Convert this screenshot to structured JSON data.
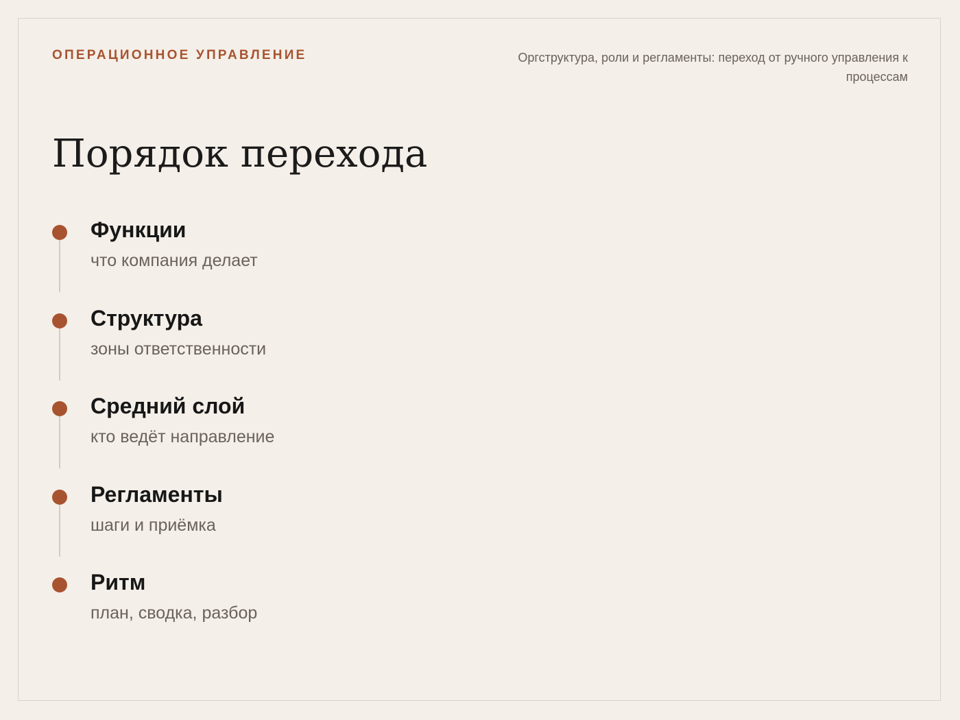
{
  "header": {
    "kicker": "ОПЕРАЦИОННОЕ УПРАВЛЕНИЕ",
    "subtitle": "Оргструктура, роли и регламенты: переход от ручного управления к процессам"
  },
  "title": "Порядок перехода",
  "steps": [
    {
      "title": "Функции",
      "desc": "что компания делает"
    },
    {
      "title": "Структура",
      "desc": "зоны ответственности"
    },
    {
      "title": "Средний слой",
      "desc": "кто ведёт направление"
    },
    {
      "title": "Регламенты",
      "desc": "шаги и приёмка"
    },
    {
      "title": "Ритм",
      "desc": "план, сводка, разбор"
    }
  ],
  "colors": {
    "accent": "#a8532f",
    "background": "#f4efe9",
    "text": "#171717",
    "muted": "#6a625b"
  }
}
